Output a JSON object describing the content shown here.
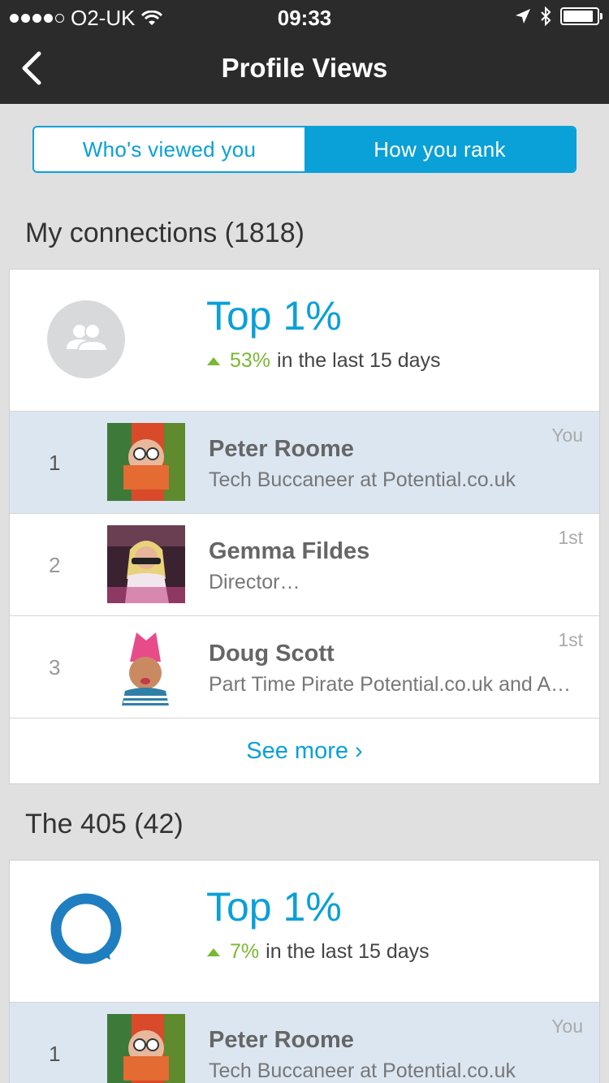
{
  "status_bar": {
    "carrier": "O2-UK",
    "time": "09:33",
    "battery_level": 0.9
  },
  "nav": {
    "title": "Profile Views",
    "back_icon": "chevron-left-icon"
  },
  "tabs": [
    {
      "label": "Who's viewed you",
      "selected": false
    },
    {
      "label": "How you rank",
      "selected": true
    }
  ],
  "colors": {
    "accent": "#0aa0d8",
    "trend_up": "#7ab833",
    "highlight_row": "#dbe6f1",
    "nav_bg": "#2b2b2b"
  },
  "sections": [
    {
      "title": "My connections (1818)",
      "icon": "people-icon",
      "top_label": "Top 1%",
      "trend_pct": "53%",
      "trend_suffix": "in the last 15 days",
      "rows": [
        {
          "rank": "1",
          "name": "Peter Roome",
          "headline": "Tech Buccaneer at Potential.co.uk",
          "degree": "You"
        },
        {
          "rank": "2",
          "name": "Gemma Fildes",
          "headline": "Director…",
          "degree": "1st"
        },
        {
          "rank": "3",
          "name": "Doug Scott",
          "headline": "Part Time Pirate Potential.co.uk and A…",
          "degree": "1st"
        }
      ],
      "see_more": "See more ›"
    },
    {
      "title": "The 405 (42)",
      "icon": "chat-bubble-icon",
      "top_label": "Top 1%",
      "trend_pct": "7%",
      "trend_suffix": "in the last 15 days",
      "rows": [
        {
          "rank": "1",
          "name": "Peter Roome",
          "headline": "Tech Buccaneer at Potential.co.uk",
          "degree": "You"
        }
      ]
    }
  ]
}
